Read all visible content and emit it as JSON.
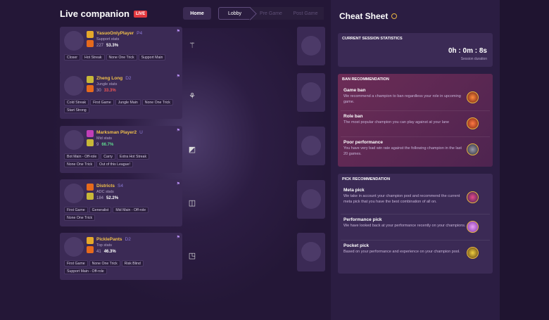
{
  "header": {
    "title": "Live companion",
    "live_badge": "LIVE",
    "home_label": "Home",
    "steps": [
      "Lobby",
      "Pre Game",
      "Post Game"
    ]
  },
  "players": [
    {
      "name": "YasuoOnlyPlayer",
      "rank": "P4",
      "role": "Support stats",
      "games": "227",
      "winrate": "53.3%",
      "winrate_color": "#ffffff",
      "tags": [
        "Closer",
        "Hot Streak",
        "None One Trick",
        "Support Main"
      ],
      "lane_icon": "support-lane-icon"
    },
    {
      "name": "Zheng Long",
      "rank": "D2",
      "role": "Jungle stats",
      "games": "30",
      "winrate": "33.3%",
      "winrate_color": "#ef5555",
      "tags": [
        "Cold Streak",
        "First Game",
        "Jungle Main",
        "None One Trick",
        "Start Strong"
      ],
      "lane_icon": "jungle-lane-icon"
    },
    {
      "name": "Marksman Player2",
      "rank": "U",
      "role": "Mid stats",
      "games": "9",
      "winrate": "66.7%",
      "winrate_color": "#5ed78e",
      "tags": [
        "Bot Main - Off-role",
        "Carry",
        "Extra Hot Streak",
        "None One Trick",
        "Out of this League!"
      ],
      "lane_icon": "mid-lane-icon"
    },
    {
      "name": "Districts",
      "rank": "S4",
      "role": "ADC stats",
      "games": "184",
      "winrate": "52.2%",
      "winrate_color": "#ffffff",
      "tags": [
        "First Game",
        "Generalist",
        "Mid Main - Off-role",
        "None One Trick"
      ],
      "lane_icon": "bot-lane-icon"
    },
    {
      "name": "PicklePants",
      "rank": "D2",
      "role": "Top stats",
      "games": "41",
      "winrate": "46.3%",
      "winrate_color": "#ffffff",
      "tags": [
        "First Game",
        "None One Trick",
        "Risk Blind",
        "Support Main - Off-role"
      ],
      "lane_icon": "top-lane-icon"
    }
  ],
  "cheat_sheet": {
    "title": "Cheat Sheet",
    "session": {
      "heading": "CURRENT SESSION STATISTICS",
      "time": "0h : 0m : 8s",
      "duration_label": "Session duration"
    },
    "ban": {
      "heading": "BAN RECOMMENDATION",
      "items": [
        {
          "title": "Game ban",
          "desc": "We recommend a champion to ban regardless your role in upcoming game."
        },
        {
          "title": "Role ban",
          "desc": "The most popular champion you can play against at your lane"
        },
        {
          "title": "Poor performance",
          "desc": "You have very bad win rate against the following champion in the last 20 games."
        }
      ]
    },
    "pick": {
      "heading": "PICK RECOMMENDATION",
      "items": [
        {
          "title": "Meta pick",
          "desc": "We take in account your champion pool and recommend the current meta pick that you have the best combination of all on."
        },
        {
          "title": "Performance pick",
          "desc": "We have looked back at your performance recently on your champions."
        },
        {
          "title": "Pocket pick",
          "desc": "Based on your performance and experience on your champion pool."
        }
      ]
    }
  }
}
